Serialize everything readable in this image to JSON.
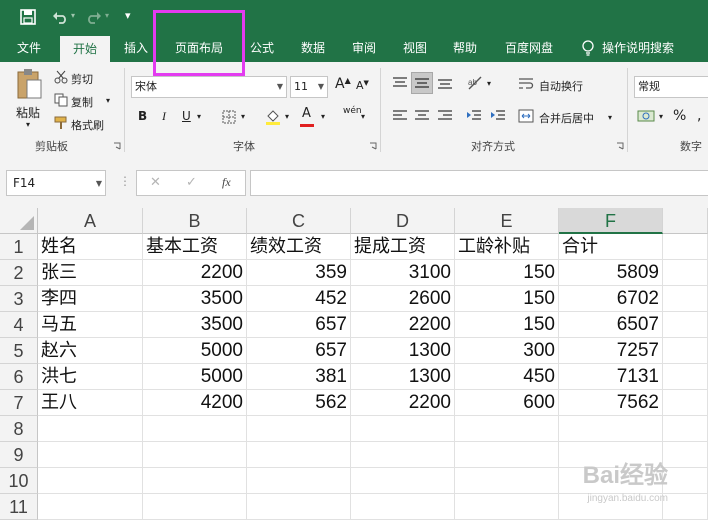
{
  "quick_access": {
    "save_icon": "save-icon",
    "undo_icon": "undo-icon",
    "redo_icon": "redo-icon",
    "customize": "▾"
  },
  "tabs": [
    {
      "label": "文件",
      "active": false
    },
    {
      "label": "开始",
      "active": true
    },
    {
      "label": "插入",
      "active": false
    },
    {
      "label": "页面布局",
      "active": false
    },
    {
      "label": "公式",
      "active": false
    },
    {
      "label": "数据",
      "active": false
    },
    {
      "label": "审阅",
      "active": false
    },
    {
      "label": "视图",
      "active": false
    },
    {
      "label": "帮助",
      "active": false
    },
    {
      "label": "百度网盘",
      "active": false
    },
    {
      "label": "操作说明搜索",
      "active": false
    }
  ],
  "ribbon": {
    "clipboard": {
      "paste": "粘贴",
      "cut": "剪切",
      "copy": "复制",
      "format_painter": "格式刷",
      "group": "剪贴板"
    },
    "font": {
      "name": "宋体",
      "size": "11",
      "bold": "B",
      "italic": "I",
      "underline": "U",
      "font_color_letter": "A",
      "group": "字体",
      "grow": "A",
      "shrink": "A",
      "wen": "wén"
    },
    "alignment": {
      "wrap": "自动换行",
      "merge": "合并后居中",
      "group": "对齐方式"
    },
    "number": {
      "format": "常规",
      "percent": "%",
      "group": "数字"
    }
  },
  "formula_bar": {
    "name_box": "F14",
    "cancel": "✕",
    "enter": "✓",
    "fx": "fx",
    "value": ""
  },
  "sheet": {
    "columns": [
      "A",
      "B",
      "C",
      "D",
      "E",
      "F"
    ],
    "selected_column": "F",
    "row_numbers": [
      "1",
      "2",
      "3",
      "4",
      "5",
      "6",
      "7",
      "8",
      "9",
      "10",
      "11"
    ],
    "header": [
      "姓名",
      "基本工资",
      "绩效工资",
      "提成工资",
      "工龄补贴",
      "合计"
    ],
    "rows": [
      [
        "张三",
        "2200",
        "359",
        "3100",
        "150",
        "5809"
      ],
      [
        "李四",
        "3500",
        "452",
        "2600",
        "150",
        "6702"
      ],
      [
        "马五",
        "3500",
        "657",
        "2200",
        "150",
        "6507"
      ],
      [
        "赵六",
        "5000",
        "657",
        "1300",
        "300",
        "7257"
      ],
      [
        "洪七",
        "5000",
        "381",
        "1300",
        "450",
        "7131"
      ],
      [
        "王八",
        "4200",
        "562",
        "2200",
        "600",
        "7562"
      ]
    ]
  },
  "watermark": {
    "text": "Bai经验",
    "url": "jingyan.baidu.com"
  },
  "colors": {
    "excel_green": "#217346",
    "highlight": "#e33bf0"
  }
}
